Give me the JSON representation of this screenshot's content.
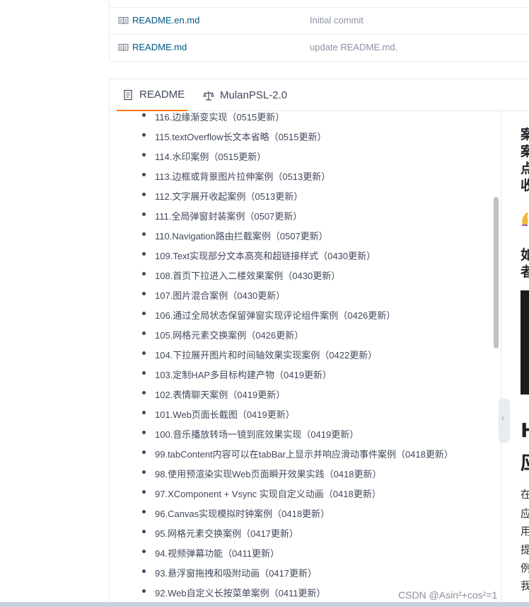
{
  "files": [
    {
      "name": "README.en.md",
      "commit": "Initial commit"
    },
    {
      "name": "README.md",
      "commit": "update README.md."
    }
  ],
  "tabs": [
    {
      "label": "README",
      "icon": "document-icon",
      "active": true
    },
    {
      "label": "MulanPSL-2.0",
      "icon": "scale-icon",
      "active": false
    }
  ],
  "items": [
    "116.边缘渐变实现（0515更新）",
    "115.textOverflow长文本省略（0515更新）",
    "114.水印案例（0515更新）",
    "113.边框或背景图片拉伸案例（0513更新）",
    "112.文字展开收起案例（0513更新）",
    "111.全局弹窗封装案例（0507更新）",
    "110.Navigation路由拦截案例（0507更新）",
    "109.Text实现部分文本高亮和超链接样式（0430更新）",
    "108.首页下拉进入二楼效果案例（0430更新）",
    "107.图片混合案例（0430更新）",
    "106.通过全局状态保留弹窗实现评论组件案例（0426更新）",
    "105.网格元素交换案例（0426更新）",
    "104.下拉展开图片和时间轴效果实现案例（0422更新）",
    "103.定制HAP多目标构建产物（0419更新）",
    "102.表情聊天案例（0419更新）",
    "101.Web页面长截图（0419更新）",
    "100.音乐播放转场一镜到底效果实现（0419更新）",
    "99.tabContent内容可以在tabBar上显示并响应滑动事件案例（0418更新）",
    "98.使用预渲染实现Web页面瞬开效果实践（0418更新）",
    "97.XComponent + Vsync 实现自定义动画（0418更新）",
    "96.Canvas实现模拟时钟案例（0418更新）",
    "95.网格元素交换案例（0417更新）",
    "94.视频弹幕功能（0411更新）",
    "93.悬浮窗拖拽和吸附动画（0417更新）",
    "92.Web自定义长按菜单案例（0411更新）"
  ],
  "side": {
    "heading_chars": [
      "案",
      "案",
      "点",
      "收"
    ],
    "sub_chars": [
      "如",
      "者"
    ],
    "big_chars": [
      "H",
      "应"
    ],
    "text_chars": [
      "在",
      "应",
      "用",
      "提",
      "例",
      "我"
    ]
  },
  "watermark": "CSDN @Asin²+cos²=1",
  "colors": {
    "accent": "#fe7300",
    "link": "#005980",
    "text": "#40485b"
  }
}
